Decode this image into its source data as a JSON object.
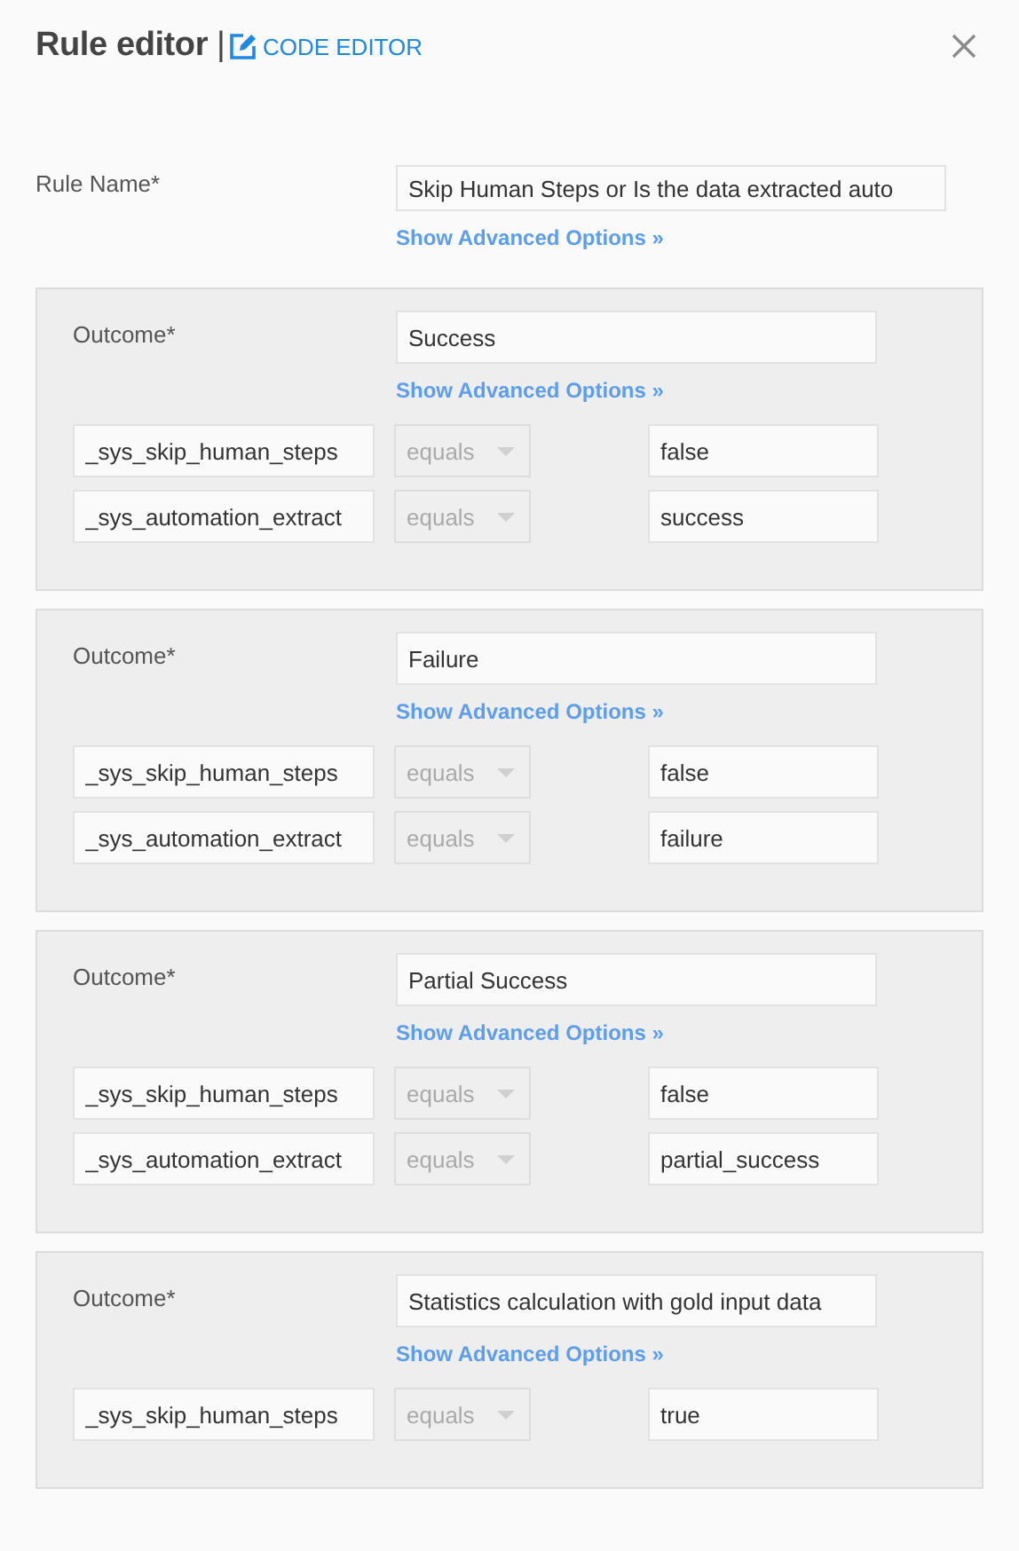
{
  "header": {
    "title": "Rule editor",
    "separator": "|",
    "code_editor_link": "CODE EDITOR"
  },
  "rule_name": {
    "label": "Rule Name*",
    "value": "Skip Human Steps or Is the data extracted auto",
    "advanced_link": "Show Advanced Options »"
  },
  "outcomes": [
    {
      "label": "Outcome*",
      "value": "Success",
      "advanced_link": "Show Advanced Options »",
      "conditions": [
        {
          "field": "_sys_skip_human_steps",
          "operator": "equals",
          "operator_disabled": true,
          "value": "false"
        },
        {
          "field": "_sys_automation_extract",
          "operator": "equals",
          "operator_disabled": true,
          "value": "success"
        }
      ]
    },
    {
      "label": "Outcome*",
      "value": "Failure",
      "advanced_link": "Show Advanced Options »",
      "conditions": [
        {
          "field": "_sys_skip_human_steps",
          "operator": "equals",
          "operator_disabled": true,
          "value": "false"
        },
        {
          "field": "_sys_automation_extract",
          "operator": "equals",
          "operator_disabled": true,
          "value": "failure"
        }
      ]
    },
    {
      "label": "Outcome*",
      "value": "Partial Success",
      "advanced_link": "Show Advanced Options »",
      "conditions": [
        {
          "field": "_sys_skip_human_steps",
          "operator": "equals",
          "operator_disabled": true,
          "value": "false"
        },
        {
          "field": "_sys_automation_extract",
          "operator": "equals",
          "operator_disabled": true,
          "value": "partial_success"
        }
      ]
    },
    {
      "label": "Outcome*",
      "value": "Statistics calculation with gold input data",
      "advanced_link": "Show Advanced Options »",
      "conditions": [
        {
          "field": "_sys_skip_human_steps",
          "operator": "equals",
          "operator_disabled": true,
          "value": "true"
        }
      ]
    }
  ]
}
